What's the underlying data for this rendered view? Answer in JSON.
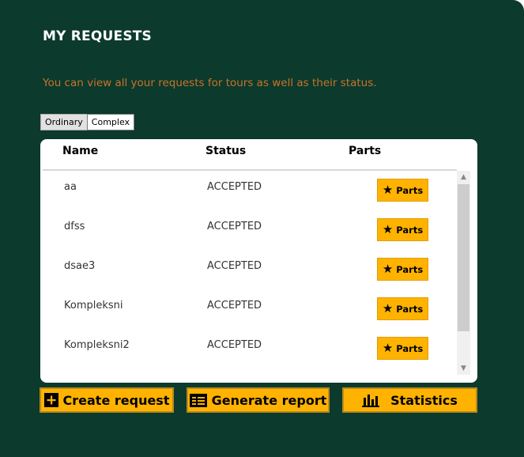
{
  "page": {
    "title": "MY REQUESTS",
    "subtitle": "You can view all your requests for tours as well as their status."
  },
  "tabs": [
    {
      "label": "Ordinary",
      "selected": false
    },
    {
      "label": "Complex",
      "selected": true
    }
  ],
  "table": {
    "columns": [
      "Name",
      "Status",
      "Parts"
    ],
    "rows": [
      {
        "name": "aa",
        "status": "ACCEPTED",
        "action": "Parts"
      },
      {
        "name": "dfss",
        "status": "ACCEPTED",
        "action": "Parts"
      },
      {
        "name": "dsae3",
        "status": "ACCEPTED",
        "action": "Parts"
      },
      {
        "name": "Kompleksni",
        "status": "ACCEPTED",
        "action": "Parts"
      },
      {
        "name": "Kompleksni2",
        "status": "ACCEPTED",
        "action": "Parts"
      }
    ],
    "action_icon": "star-icon"
  },
  "actions": {
    "create": {
      "label": "Create request",
      "icon": "plus-square-icon"
    },
    "report": {
      "label": "Generate report",
      "icon": "report-icon"
    },
    "statistics": {
      "label": "Statistics",
      "icon": "bar-chart-icon"
    }
  },
  "colors": {
    "background": "#0c3a2d",
    "accent": "#ffb300",
    "subtitle": "#c8732a"
  }
}
